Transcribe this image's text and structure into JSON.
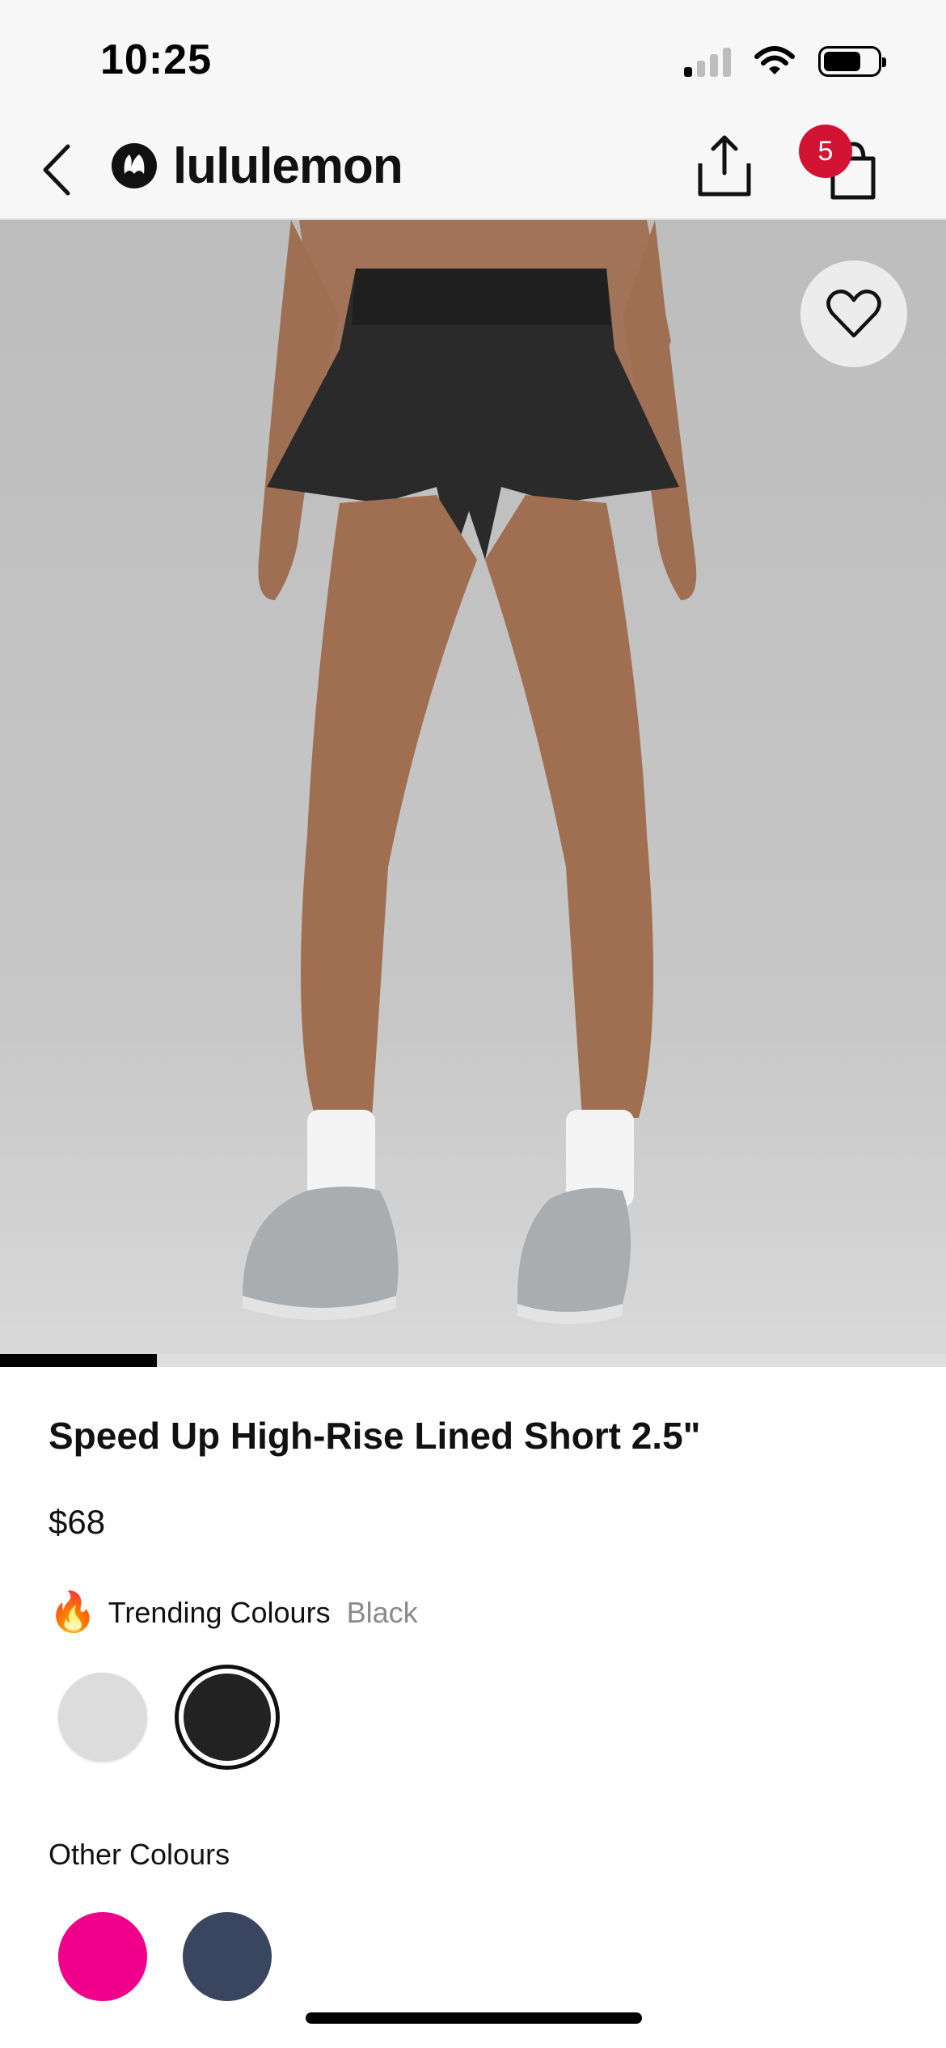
{
  "status_bar": {
    "time": "10:25"
  },
  "nav": {
    "brand": "lululemon",
    "cart_count": "5"
  },
  "gallery": {
    "progress": 0.166
  },
  "product": {
    "title": "Speed Up High-Rise Lined Short 2.5\"",
    "price": "$68"
  },
  "trending": {
    "label": "Trending Colours",
    "selected": "Black",
    "swatches": [
      {
        "name": "Light Grey",
        "color": "#dcdcdc"
      },
      {
        "name": "Black",
        "color": "#222222",
        "selected": true
      }
    ]
  },
  "other_colours": {
    "label": "Other Colours",
    "swatches": [
      {
        "name": "Pink",
        "color": "#f0008a"
      },
      {
        "name": "Navy",
        "color": "#3a4660"
      }
    ]
  },
  "colors": {
    "badge": "#d31334",
    "accent": "#000000"
  }
}
